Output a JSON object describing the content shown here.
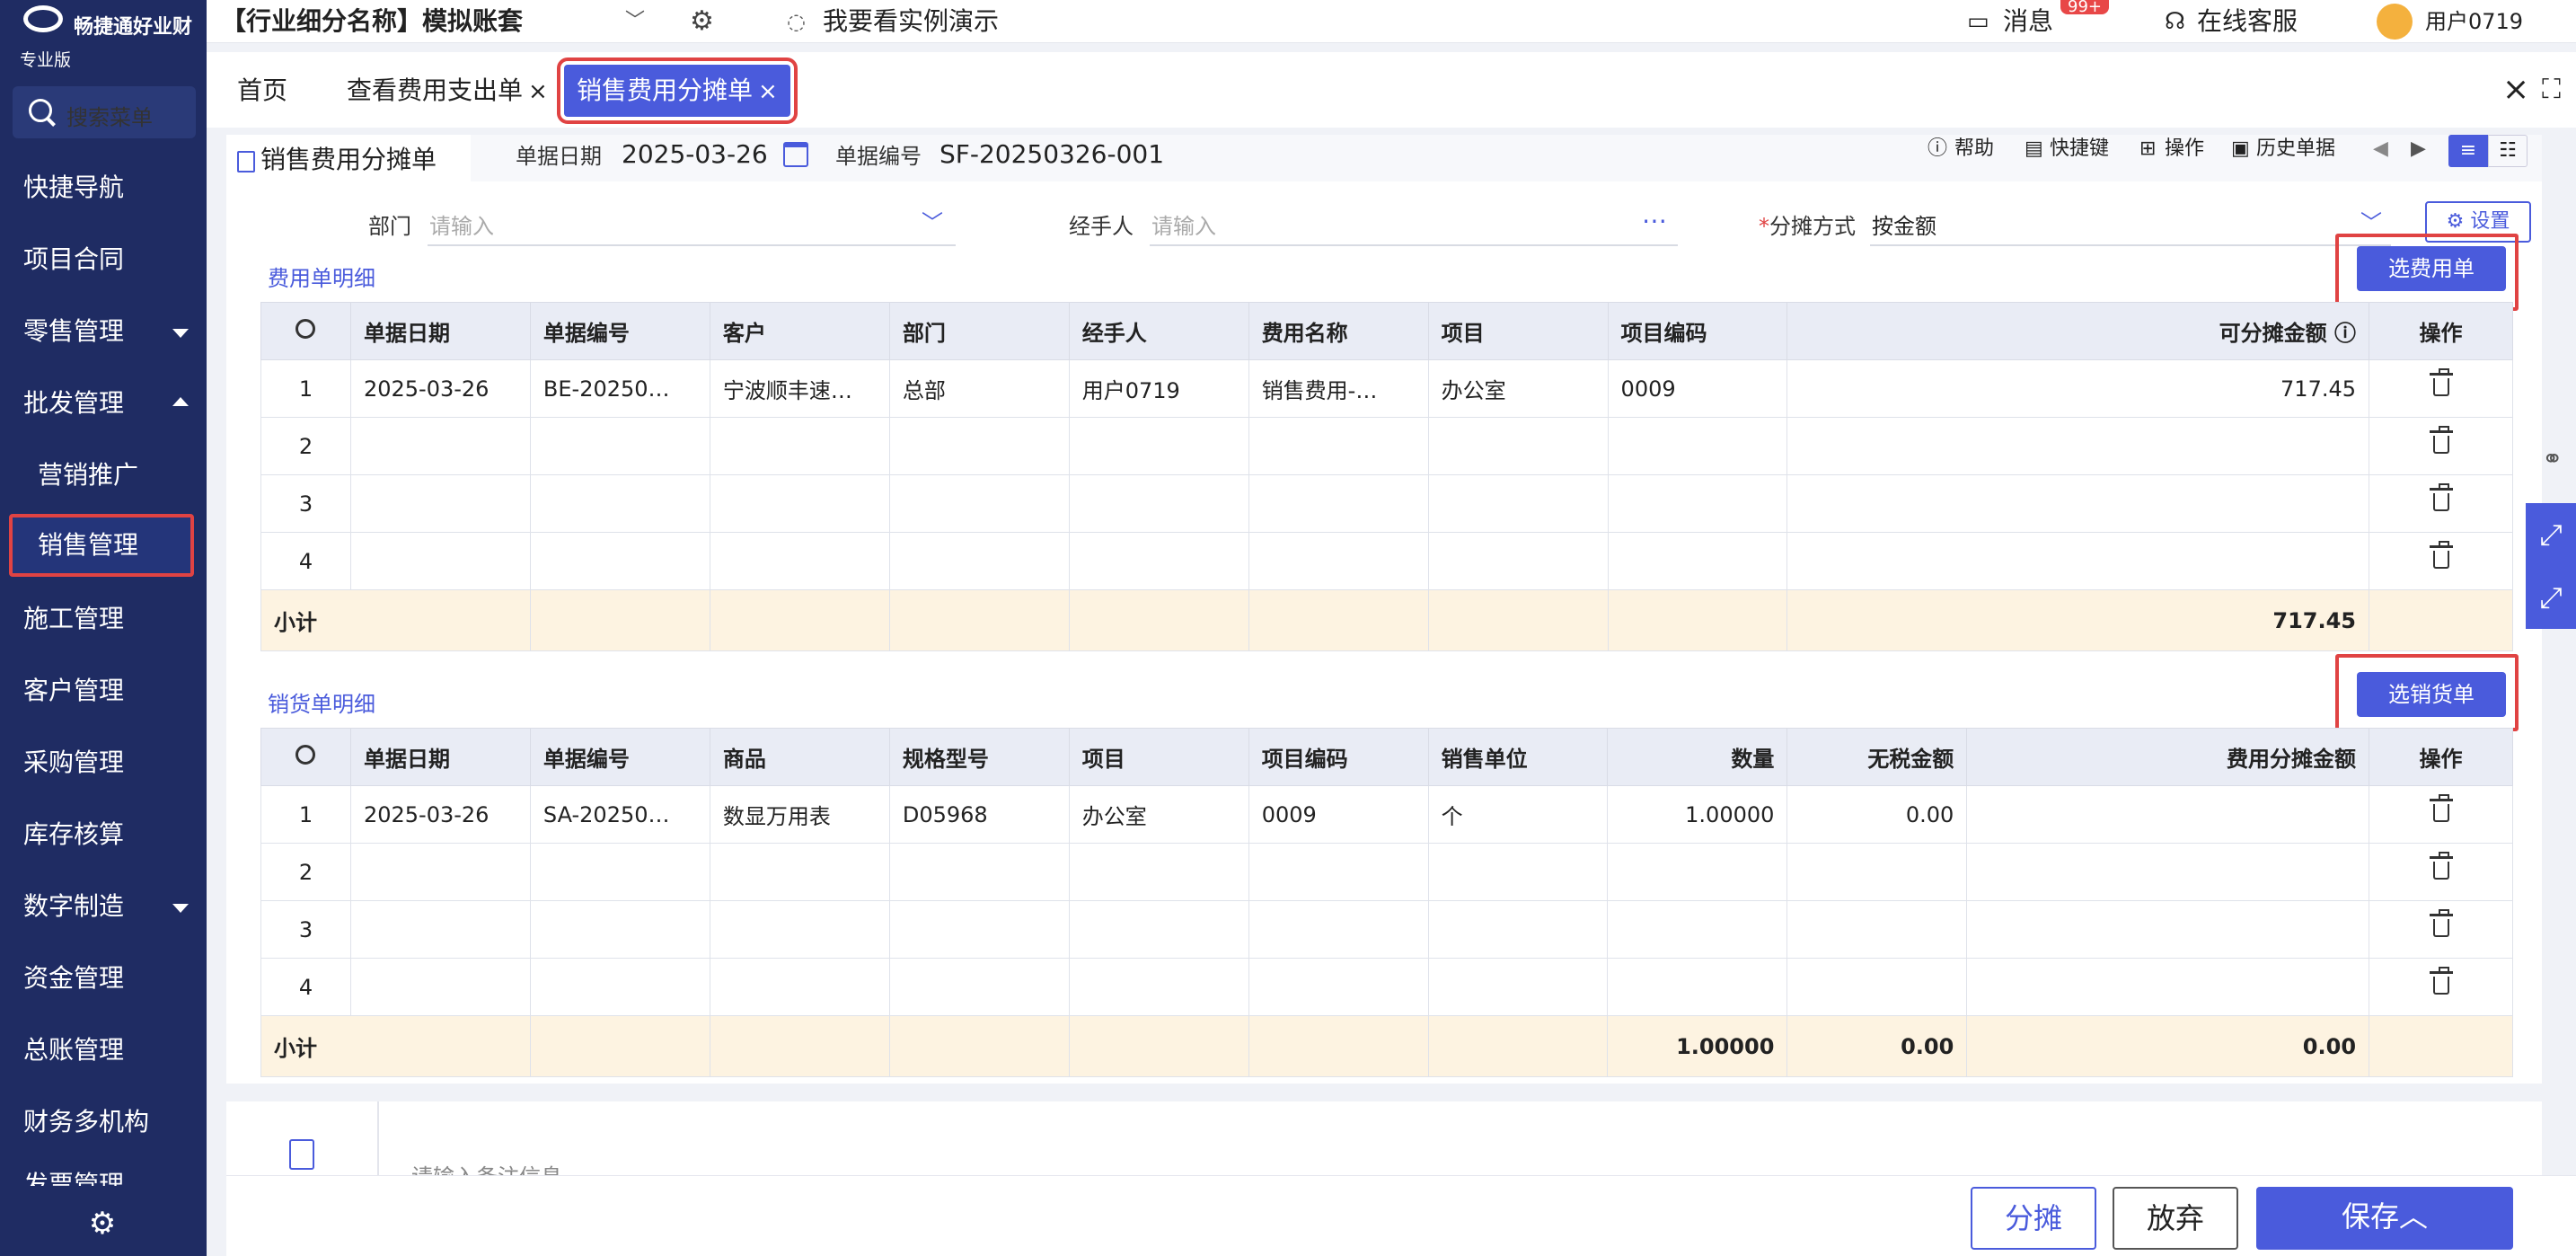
{
  "brand": {
    "name": "畅捷通好业财",
    "edition": "专业版"
  },
  "sidebar": {
    "search_label": "搜索菜单",
    "items": [
      {
        "label": "快捷导航"
      },
      {
        "label": "项目合同"
      },
      {
        "label": "零售管理"
      },
      {
        "label": "批发管理"
      },
      {
        "label": "营销推广"
      },
      {
        "label": "销售管理"
      },
      {
        "label": "施工管理"
      },
      {
        "label": "客户管理"
      },
      {
        "label": "采购管理"
      },
      {
        "label": "库存核算"
      },
      {
        "label": "数字制造"
      },
      {
        "label": "资金管理"
      },
      {
        "label": "总账管理"
      },
      {
        "label": "财务多机构"
      },
      {
        "label": "发票管理"
      }
    ]
  },
  "topbar": {
    "account": "【行业细分名称】模拟账套",
    "demo": "我要看实例演示",
    "messages": "消息",
    "message_badge": "99+",
    "support": "在线客服",
    "user": "用户0719"
  },
  "tabs": [
    {
      "label": "首页"
    },
    {
      "label": "查看费用支出单"
    },
    {
      "label": "销售费用分摊单"
    }
  ],
  "form": {
    "tab_title": "销售费用分摊单",
    "date_label": "单据日期",
    "date_value": "2025-03-26",
    "no_label": "单据编号",
    "no_value": "SF-20250326-001",
    "toolbar": {
      "help": "帮助",
      "shortcut": "快捷键",
      "ops": "操作",
      "history": "历史单据"
    },
    "dept_label": "部门",
    "dept_placeholder": "请输入",
    "handler_label": "经手人",
    "handler_placeholder": "请输入",
    "method_label": "分摊方式",
    "method_value": "按金额",
    "settings": "设置"
  },
  "expense": {
    "title": "费用单明细",
    "select_button": "选费用单",
    "columns": [
      "单据日期",
      "单据编号",
      "客户",
      "部门",
      "经手人",
      "费用名称",
      "项目",
      "项目编码",
      "可分摊金额",
      "操作"
    ],
    "rows": [
      {
        "n": "1",
        "date": "2025-03-26",
        "no": "BE-20250…",
        "customer": "宁波顺丰速…",
        "dept": "总部",
        "handler": "用户0719",
        "fee": "销售费用-…",
        "project": "办公室",
        "code": "0009",
        "amount": "717.45"
      },
      {
        "n": "2",
        "date": "",
        "no": "",
        "customer": "",
        "dept": "",
        "handler": "",
        "fee": "",
        "project": "",
        "code": "",
        "amount": ""
      },
      {
        "n": "3",
        "date": "",
        "no": "",
        "customer": "",
        "dept": "",
        "handler": "",
        "fee": "",
        "project": "",
        "code": "",
        "amount": ""
      },
      {
        "n": "4",
        "date": "",
        "no": "",
        "customer": "",
        "dept": "",
        "handler": "",
        "fee": "",
        "project": "",
        "code": "",
        "amount": ""
      }
    ],
    "subtotal_label": "小计",
    "subtotal_amount": "717.45"
  },
  "sales": {
    "title": "销货单明细",
    "select_button": "选销货单",
    "columns": [
      "单据日期",
      "单据编号",
      "商品",
      "规格型号",
      "项目",
      "项目编码",
      "销售单位",
      "数量",
      "无税金额",
      "费用分摊金额",
      "操作"
    ],
    "rows": [
      {
        "n": "1",
        "date": "2025-03-26",
        "no": "SA-20250…",
        "goods": "数显万用表",
        "spec": "D05968",
        "project": "办公室",
        "code": "0009",
        "unit": "个",
        "qty": "1.00000",
        "net": "0.00",
        "alloc": ""
      },
      {
        "n": "2",
        "date": "",
        "no": "",
        "goods": "",
        "spec": "",
        "project": "",
        "code": "",
        "unit": "",
        "qty": "",
        "net": "",
        "alloc": ""
      },
      {
        "n": "3",
        "date": "",
        "no": "",
        "goods": "",
        "spec": "",
        "project": "",
        "code": "",
        "unit": "",
        "qty": "",
        "net": "",
        "alloc": ""
      },
      {
        "n": "4",
        "date": "",
        "no": "",
        "goods": "",
        "spec": "",
        "project": "",
        "code": "",
        "unit": "",
        "qty": "",
        "net": "",
        "alloc": ""
      }
    ],
    "subtotal_label": "小计",
    "subtotal_qty": "1.00000",
    "subtotal_net": "0.00",
    "subtotal_alloc": "0.00"
  },
  "memo_placeholder": "请输入备注信息",
  "bottom": {
    "allocate": "分摊",
    "discard": "放弃",
    "save": "保存"
  },
  "colors": {
    "sidebar": "#1f2c63",
    "accent": "#4a5bdc",
    "highlight": "#e04343",
    "subtotal": "#fdf3e1"
  }
}
